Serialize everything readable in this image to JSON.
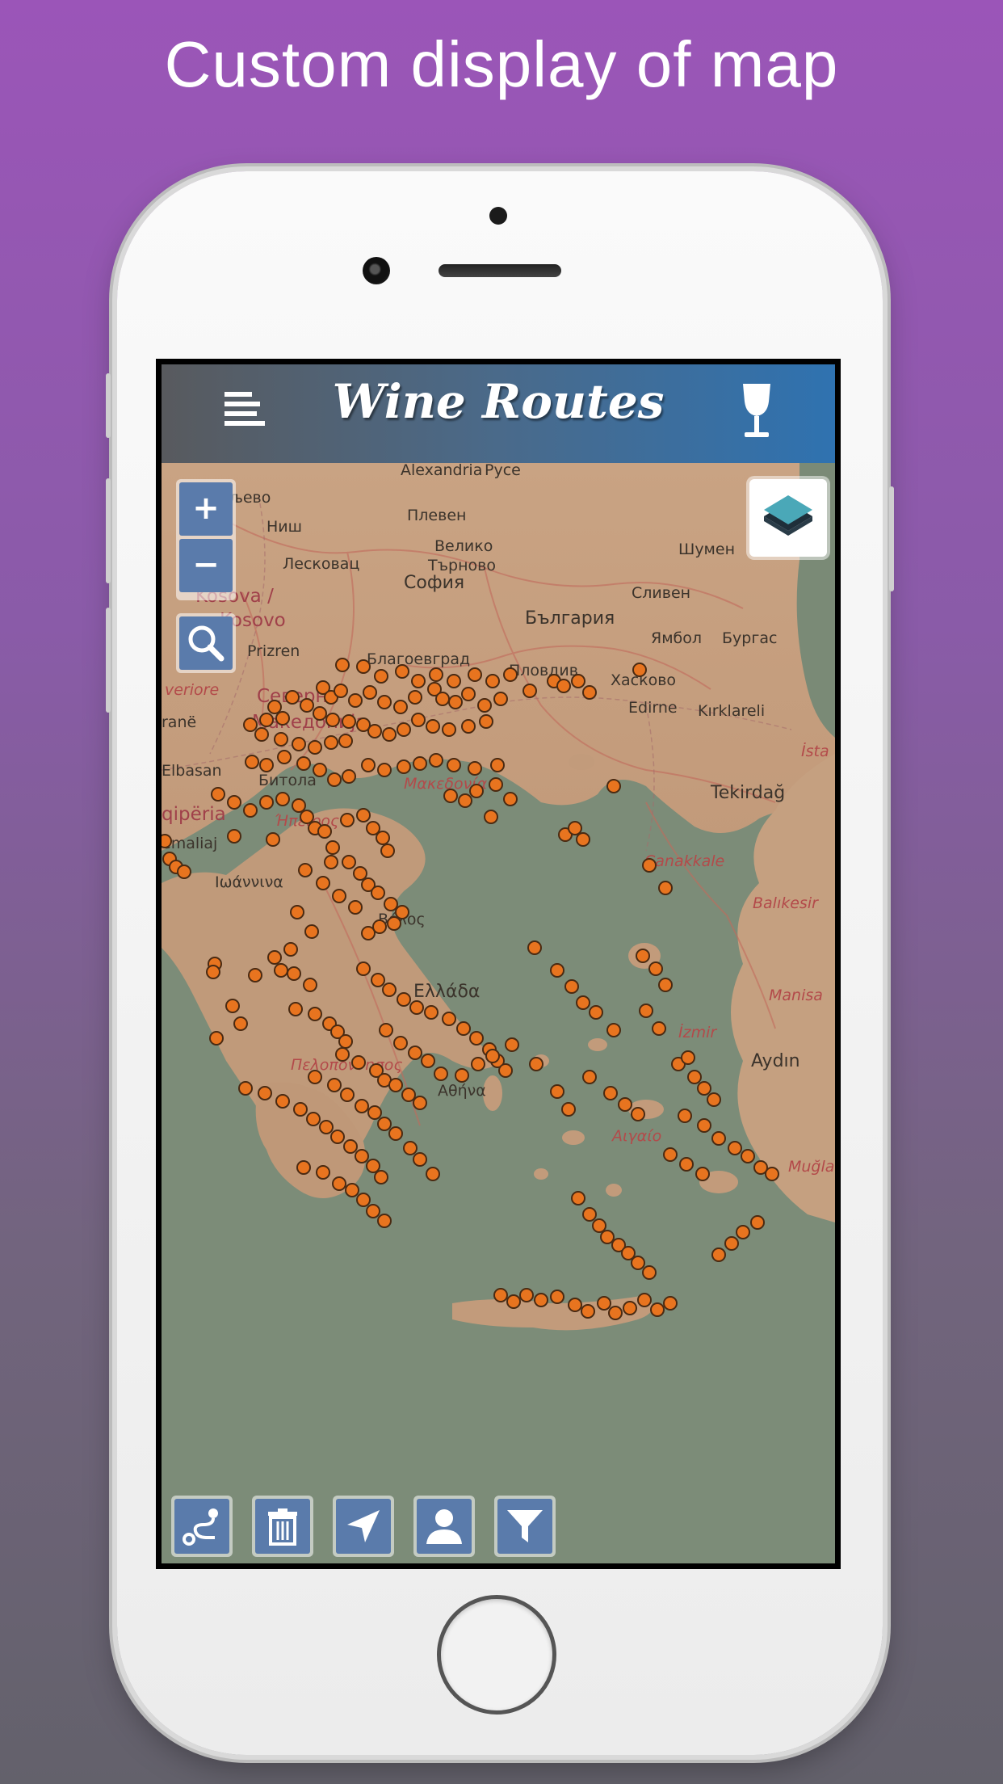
{
  "headline": "Custom display of map",
  "app": {
    "title": "Wine Routes",
    "menu_icon": "menu-icon",
    "wine_icon": "wine-glass-icon"
  },
  "map": {
    "labels": {
      "alexandria": "Alexandria",
      "ruse": "Русе",
      "pleven": "Плевен",
      "veliko": "Велико",
      "tarnovo": "Търново",
      "shumen": "Шумен",
      "sofia": "София",
      "bulgaria": "България",
      "sliven": "Сливен",
      "yambol": "Ямбол",
      "burgas": "Бургас",
      "nish": "Ниш",
      "leskovac": "Лесковац",
      "kosova": "Kosova /",
      "kosovo": "Kosovo",
      "prizren": "Prizren",
      "blagoevgrad": "Благоевград",
      "plovdiv": "Пловдив",
      "haskovo": "Хасково",
      "edirne": "Edirne",
      "kirklareli": "Kırklareli",
      "north_macedonia_1": "Северна",
      "north_macedonia_2": "Македонија",
      "elbasan": "Elbasan",
      "bitola": "Битола",
      "shqiperia": "qipëria",
      "tekirdag": "Tekirdağ",
      "canakkale": "Çanakkale",
      "balikesir": "Balıkesir",
      "manisa": "Manisa",
      "izmir": "İzmir",
      "aydin": "Aydın",
      "mugla": "Muğla",
      "ellada": "Ελλάδα",
      "athina": "Αθήνα",
      "aigaio": "Αιγαίο",
      "makedonia": "Μακεδονία",
      "ipeiros": "Ήπειρος",
      "peloponnisos": "Πελοπόννησος",
      "volos": "Βόλος",
      "ioannina": "Ιωάννινα",
      "istanbul": "İsta",
      "ane": "ranë",
      "emaliaj": "emaliaj",
      "ljevo": "раљево",
      "veriore": "veriore"
    },
    "zoom_in": "+",
    "zoom_out": "−",
    "marker_color": "#e8741f"
  },
  "controls": {
    "search": "search-icon",
    "layers": "layers-icon",
    "toolbar": [
      "route-icon",
      "trash-icon",
      "locate-icon",
      "user-icon",
      "filter-icon"
    ]
  }
}
